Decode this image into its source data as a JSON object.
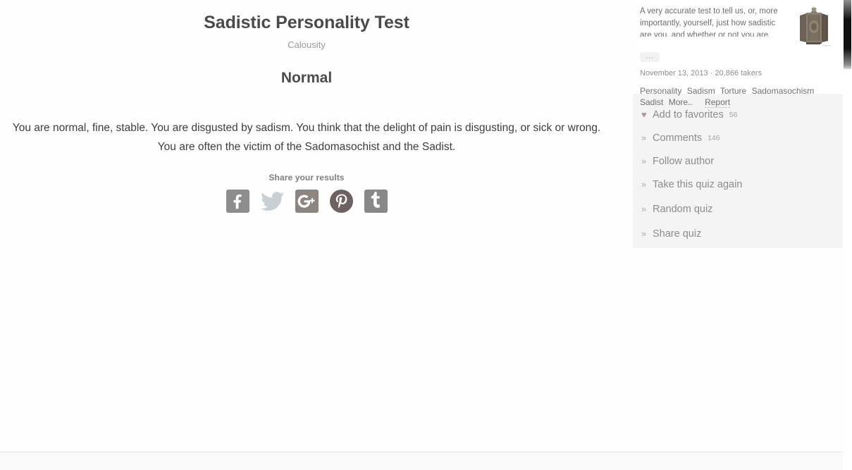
{
  "quiz": {
    "title": "Sadistic Personality Test",
    "subtitle": "Calousity",
    "result_name": "Normal",
    "result_text": "You are normal, fine, stable. You are disgusted by sadism. You think that the delight of pain is disgusting, or sick or wrong. You are often the victim of the Sadomasochist and the Sadist."
  },
  "share": {
    "label": "Share your results",
    "buttons": [
      {
        "icon": "facebook-icon",
        "name": "Facebook",
        "color": "#8d8d8d"
      },
      {
        "icon": "twitter-icon",
        "name": "Twitter",
        "color": "#c5cdd2"
      },
      {
        "icon": "googleplus-icon",
        "name": "Google+",
        "color": "#8f8580"
      },
      {
        "icon": "pinterest-icon",
        "name": "Pinterest",
        "color": "#6d6161"
      },
      {
        "icon": "tumblr-icon",
        "name": "Tumblr",
        "color": "#86888a"
      }
    ]
  },
  "sidebar": {
    "description": "A very accurate test to tell us, or, more importantly, yourself, just how sadistic are you, and whether or not you are suffering",
    "expand_label": "...",
    "thumbnail_alt": "iron-maiden-thumbnail",
    "date": "November 13, 2013",
    "separator": "·",
    "takers": "20,866 takers",
    "tags": [
      "Personality",
      "Sadism",
      "Torture",
      "Sadomasochism",
      "Sadist",
      "More.."
    ],
    "report_label": "Report",
    "actions": [
      {
        "icon": "heart-icon",
        "bullet": "♥",
        "label": "Add to favorites",
        "count": "56"
      },
      {
        "icon": "chevron-right-icon",
        "bullet": "»",
        "label": "Comments",
        "count": "146"
      },
      {
        "icon": "chevron-right-icon",
        "bullet": "»",
        "label": "Follow author",
        "count": ""
      },
      {
        "icon": "chevron-right-icon",
        "bullet": "»",
        "label": "Take this quiz again",
        "count": ""
      },
      {
        "icon": "chevron-right-icon",
        "bullet": "»",
        "label": "Random quiz",
        "count": ""
      },
      {
        "icon": "chevron-right-icon",
        "bullet": "»",
        "label": "Share quiz",
        "count": ""
      }
    ]
  },
  "colors": {
    "page_background": "#ffffff",
    "sidebar_panel": "#f4f4f4",
    "text_primary": "#3d3d3d",
    "text_muted": "#8c8c8c",
    "heading": "#4a4a4a"
  }
}
